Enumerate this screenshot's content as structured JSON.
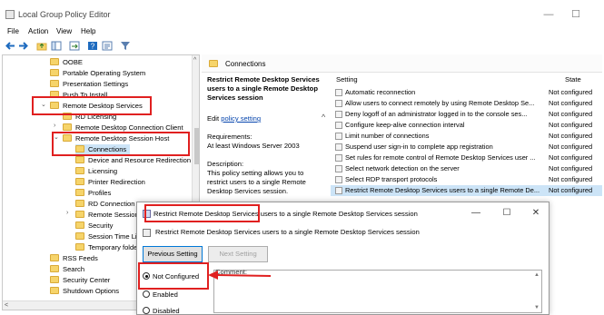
{
  "window": {
    "title": "Local Group Policy Editor",
    "minimize": "—",
    "maximize": "☐"
  },
  "menu": [
    "File",
    "Action",
    "View",
    "Help"
  ],
  "tree": {
    "items": [
      {
        "label": "OOBE",
        "indent": 52,
        "arrow": ""
      },
      {
        "label": "Portable Operating System",
        "indent": 52,
        "arrow": ""
      },
      {
        "label": "Presentation Settings",
        "indent": 52,
        "arrow": ""
      },
      {
        "label": "Push To Install",
        "indent": 52,
        "arrow": ""
      },
      {
        "label": "Remote Desktop Services",
        "indent": 52,
        "arrow": "⌄"
      },
      {
        "label": "RD Licensing",
        "indent": 66,
        "arrow": ""
      },
      {
        "label": "Remote Desktop Connection Client",
        "indent": 66,
        "arrow": "›"
      },
      {
        "label": "Remote Desktop Session Host",
        "indent": 66,
        "arrow": "⌄"
      },
      {
        "label": "Connections",
        "indent": 80,
        "arrow": ""
      },
      {
        "label": "Device and Resource Redirection",
        "indent": 80,
        "arrow": ""
      },
      {
        "label": "Licensing",
        "indent": 80,
        "arrow": ""
      },
      {
        "label": "Printer Redirection",
        "indent": 80,
        "arrow": ""
      },
      {
        "label": "Profiles",
        "indent": 80,
        "arrow": ""
      },
      {
        "label": "RD Connection B",
        "indent": 80,
        "arrow": ""
      },
      {
        "label": "Remote Session",
        "indent": 80,
        "arrow": "›"
      },
      {
        "label": "Security",
        "indent": 80,
        "arrow": ""
      },
      {
        "label": "Session Time Li",
        "indent": 80,
        "arrow": ""
      },
      {
        "label": "Temporary folde",
        "indent": 80,
        "arrow": ""
      },
      {
        "label": "RSS Feeds",
        "indent": 52,
        "arrow": ""
      },
      {
        "label": "Search",
        "indent": 52,
        "arrow": ""
      },
      {
        "label": "Security Center",
        "indent": 52,
        "arrow": ""
      },
      {
        "label": "Shutdown Options",
        "indent": 52,
        "arrow": ""
      }
    ]
  },
  "crumb": {
    "label": "Connections"
  },
  "description": {
    "heading": "Restrict Remote Desktop Services users to a single Remote Desktop Services session",
    "edit_prefix": "Edit",
    "edit_link": "policy setting",
    "requirements": "Requirements:\nAt least Windows Server 2003",
    "description": "Description:\nThis policy setting allows you to restrict users to a single Remote Desktop Services session."
  },
  "list": {
    "col_setting": "Setting",
    "col_state": "State",
    "rows": [
      {
        "name": "Automatic reconnection",
        "state": "Not configured"
      },
      {
        "name": "Allow users to connect remotely by using Remote Desktop Se...",
        "state": "Not configured"
      },
      {
        "name": "Deny logoff of an administrator logged in to the console ses...",
        "state": "Not configured"
      },
      {
        "name": "Configure keep-alive connection interval",
        "state": "Not configured"
      },
      {
        "name": "Limit number of connections",
        "state": "Not configured"
      },
      {
        "name": "Suspend user sign-in to complete app registration",
        "state": "Not configured"
      },
      {
        "name": "Set rules for remote control of Remote Desktop Services user ...",
        "state": "Not configured"
      },
      {
        "name": "Select network detection on the server",
        "state": "Not configured"
      },
      {
        "name": "Select RDP transport protocols",
        "state": "Not configured"
      },
      {
        "name": "Restrict Remote Desktop Services users to a single Remote De...",
        "state": "Not configured"
      }
    ]
  },
  "dialog": {
    "title": "Restrict Remote Desktop Services users to a single Remote Desktop Services session",
    "subtitle": "Restrict Remote Desktop Services users to a single Remote Desktop Services session",
    "minimize": "—",
    "maximize": "☐",
    "close": "✕",
    "prev_button": "Previous Setting",
    "next_button": "Next Setting",
    "comment_label": "Comment:",
    "options": [
      {
        "label": "Not Configured",
        "checked": true
      },
      {
        "label": "Enabled",
        "checked": false
      },
      {
        "label": "Disabled",
        "checked": false
      }
    ]
  },
  "colors": {
    "annotation": "#e02020",
    "selection": "#cce4f7",
    "link": "#0645ad"
  }
}
